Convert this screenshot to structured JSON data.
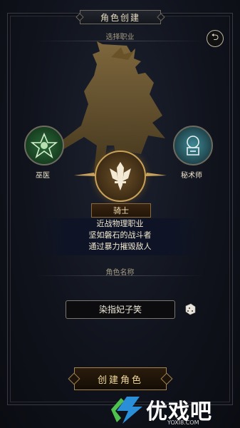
{
  "header": {
    "title": "角色创建"
  },
  "select_class": {
    "label": "选择职业"
  },
  "classes": [
    {
      "name": "巫医",
      "icon": "witch-doctor-emblem-icon",
      "color": "#3a8a4a"
    },
    {
      "name": "骑士",
      "icon": "knight-emblem-icon",
      "color": "#c9a25a"
    },
    {
      "name": "秘术师",
      "icon": "arcanist-emblem-icon",
      "color": "#4a8a96"
    }
  ],
  "selected_class": {
    "name": "骑士",
    "description": [
      "近战物理职业",
      "坚如磐石的战斗者",
      "通过暴力摧毁敌人"
    ]
  },
  "role_name": {
    "label": "角色名称",
    "value": "染指妃子笑"
  },
  "create_button": {
    "label": "创建角色"
  },
  "watermark": {
    "text": "优戏吧",
    "sub": "YOXI8.COM"
  }
}
